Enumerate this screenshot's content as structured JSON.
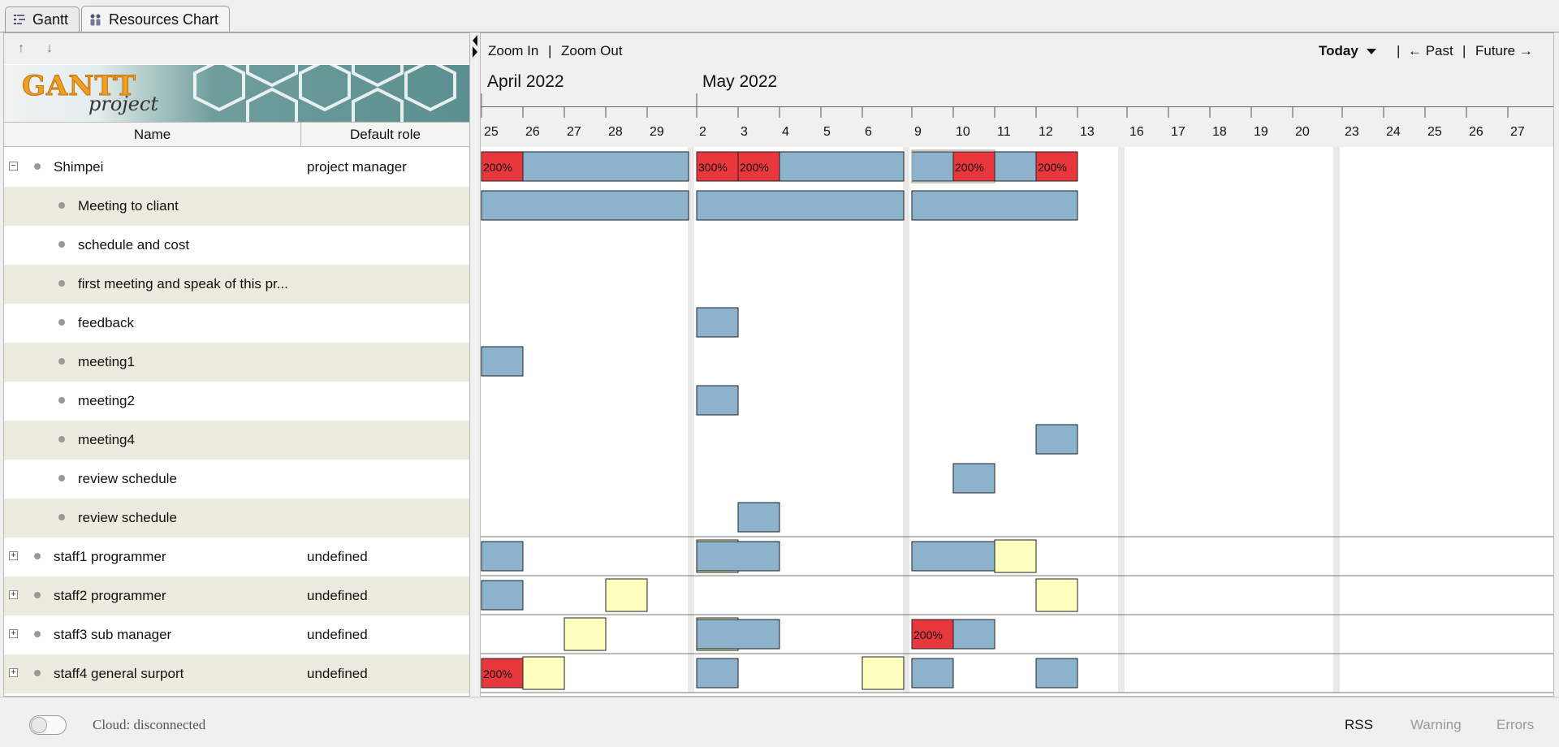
{
  "tabs": [
    {
      "label": "Gantt",
      "icon": "gantt-icon",
      "active": false
    },
    {
      "label": "Resources Chart",
      "icon": "resources-icon",
      "active": true
    }
  ],
  "left": {
    "logo_text": {
      "main": "GANTT",
      "sub": "project"
    },
    "columns": {
      "name": "Name",
      "role": "Default role"
    }
  },
  "resources": [
    {
      "name": "Shimpei",
      "role": "project manager",
      "level": 0,
      "expander": "−"
    },
    {
      "name": "Meeting to cliant",
      "role": "",
      "level": 1,
      "expander": ""
    },
    {
      "name": "schedule and cost",
      "role": "",
      "level": 1,
      "expander": ""
    },
    {
      "name": "first meeting and speak of this pr...",
      "role": "",
      "level": 1,
      "expander": ""
    },
    {
      "name": "feedback",
      "role": "",
      "level": 1,
      "expander": ""
    },
    {
      "name": "meeting1",
      "role": "",
      "level": 1,
      "expander": ""
    },
    {
      "name": "meeting2",
      "role": "",
      "level": 1,
      "expander": ""
    },
    {
      "name": "meeting4",
      "role": "",
      "level": 1,
      "expander": ""
    },
    {
      "name": "review schedule",
      "role": "",
      "level": 1,
      "expander": ""
    },
    {
      "name": "review schedule",
      "role": "",
      "level": 1,
      "expander": ""
    },
    {
      "name": "staff1 programmer",
      "role": "undefined",
      "level": 0,
      "expander": "+"
    },
    {
      "name": "staff2 programmer",
      "role": "undefined",
      "level": 0,
      "expander": "+"
    },
    {
      "name": "staff3 sub manager",
      "role": "undefined",
      "level": 0,
      "expander": "+"
    },
    {
      "name": "staff4 general surport",
      "role": "undefined",
      "level": 0,
      "expander": "+"
    }
  ],
  "toolbar": {
    "zoom_in": "Zoom In",
    "sep": "|",
    "zoom_out": "Zoom Out",
    "today": "Today",
    "past": "← Past",
    "future": "Future →"
  },
  "timeline": {
    "months": [
      {
        "label": "April 2022",
        "day_index": 0
      },
      {
        "label": "May 2022",
        "day_index": 5
      }
    ],
    "days": [
      "25",
      "26",
      "27",
      "28",
      "29",
      "2",
      "3",
      "4",
      "5",
      "6",
      "9",
      "10",
      "11",
      "12",
      "13",
      "16",
      "17",
      "18",
      "19",
      "20",
      "23",
      "24",
      "25",
      "26",
      "27"
    ],
    "weekend_breaks_after": [
      4,
      9,
      14,
      19
    ]
  },
  "chart_data": {
    "type": "gantt",
    "colors": {
      "normal": "#8db3cc",
      "overload": "#e8383d",
      "underload": "#ffffc0"
    },
    "bars": [
      {
        "row": 0,
        "start": 0,
        "end": 5,
        "kind": "normal"
      },
      {
        "row": 0,
        "start": 0,
        "end": 1,
        "kind": "overload",
        "label": "200%"
      },
      {
        "row": 0,
        "start": 5,
        "end": 10,
        "kind": "normal"
      },
      {
        "row": 0,
        "start": 5,
        "end": 6,
        "kind": "overload",
        "label": "300%"
      },
      {
        "row": 0,
        "start": 6,
        "end": 7,
        "kind": "overload",
        "label": "200%"
      },
      {
        "row": 0,
        "start": 10,
        "end": 14,
        "kind": "normal"
      },
      {
        "row": 0,
        "start": 10,
        "end": 12,
        "kind": "frame"
      },
      {
        "row": 0,
        "start": 11,
        "end": 12,
        "kind": "overload",
        "label": "200%"
      },
      {
        "row": 0,
        "start": 13,
        "end": 14,
        "kind": "overload",
        "label": "200%"
      },
      {
        "row": 1,
        "start": 0,
        "end": 5,
        "kind": "normal"
      },
      {
        "row": 1,
        "start": 5,
        "end": 10,
        "kind": "normal"
      },
      {
        "row": 1,
        "start": 10,
        "end": 14,
        "kind": "normal"
      },
      {
        "row": 4,
        "start": 5,
        "end": 6,
        "kind": "normal"
      },
      {
        "row": 5,
        "start": 0,
        "end": 1,
        "kind": "normal"
      },
      {
        "row": 6,
        "start": 5,
        "end": 6,
        "kind": "normal"
      },
      {
        "row": 7,
        "start": 13,
        "end": 14,
        "kind": "normal"
      },
      {
        "row": 8,
        "start": 11,
        "end": 12,
        "kind": "normal"
      },
      {
        "row": 9,
        "start": 6,
        "end": 7,
        "kind": "normal"
      },
      {
        "row": 10,
        "start": 0,
        "end": 1,
        "kind": "normal"
      },
      {
        "row": 10,
        "start": 5,
        "end": 6,
        "kind": "underload"
      },
      {
        "row": 10,
        "start": 5,
        "end": 7,
        "kind": "normal"
      },
      {
        "row": 10,
        "start": 10,
        "end": 12,
        "kind": "normal"
      },
      {
        "row": 10,
        "start": 12,
        "end": 13,
        "kind": "underload"
      },
      {
        "row": 11,
        "start": 0,
        "end": 1,
        "kind": "normal"
      },
      {
        "row": 11,
        "start": 3,
        "end": 4,
        "kind": "underload"
      },
      {
        "row": 11,
        "start": 13,
        "end": 14,
        "kind": "underload"
      },
      {
        "row": 12,
        "start": 2,
        "end": 3,
        "kind": "underload"
      },
      {
        "row": 12,
        "start": 5,
        "end": 6,
        "kind": "underload"
      },
      {
        "row": 12,
        "start": 5,
        "end": 7,
        "kind": "normal"
      },
      {
        "row": 12,
        "start": 10,
        "end": 12,
        "kind": "normal"
      },
      {
        "row": 12,
        "start": 10,
        "end": 11,
        "kind": "overload",
        "label": "200%"
      },
      {
        "row": 13,
        "start": 0,
        "end": 1,
        "kind": "overload",
        "label": "200%"
      },
      {
        "row": 13,
        "start": 1,
        "end": 2,
        "kind": "underload"
      },
      {
        "row": 13,
        "start": 5,
        "end": 6,
        "kind": "normal"
      },
      {
        "row": 13,
        "start": 9,
        "end": 10,
        "kind": "underload"
      },
      {
        "row": 13,
        "start": 10,
        "end": 11,
        "kind": "normal"
      },
      {
        "row": 13,
        "start": 13,
        "end": 14,
        "kind": "normal"
      }
    ]
  },
  "status": {
    "cloud": "Cloud: disconnected",
    "rss": "RSS",
    "warning": "Warning",
    "errors": "Errors"
  }
}
